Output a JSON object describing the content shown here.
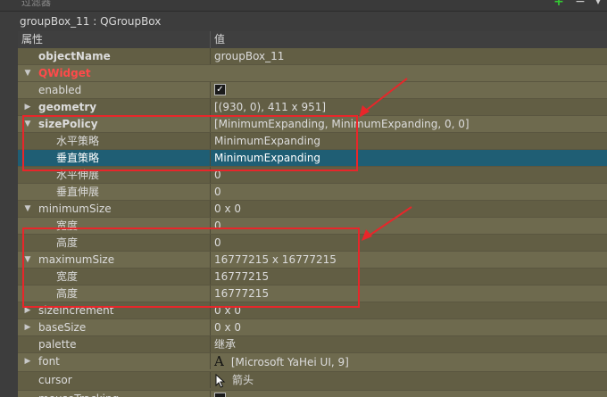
{
  "toolbar": {
    "filter_label": "过滤器",
    "add_icon": "plus-icon",
    "remove_icon": "minus-icon",
    "config_icon": "wrench-icon"
  },
  "object_title": "groupBox_11 : QGroupBox",
  "header": {
    "property": "属性",
    "value": "值"
  },
  "rows": [
    {
      "name": "objectName",
      "value": "groupBox_11"
    },
    {
      "name": "QWidget",
      "value": ""
    },
    {
      "name": "enabled",
      "value": "✓"
    },
    {
      "name": "geometry",
      "value": "[(930, 0), 411 x 951]"
    },
    {
      "name": "sizePolicy",
      "value": "[MinimumExpanding, MinimumExpanding, 0, 0]"
    },
    {
      "name": "水平策略",
      "value": "MinimumExpanding"
    },
    {
      "name": "垂直策略",
      "value": "MinimumExpanding"
    },
    {
      "name": "水平伸展",
      "value": "0"
    },
    {
      "name": "垂直伸展",
      "value": "0"
    },
    {
      "name": "minimumSize",
      "value": "0 x 0"
    },
    {
      "name": "宽度",
      "value": "0"
    },
    {
      "name": "高度",
      "value": "0"
    },
    {
      "name": "maximumSize",
      "value": "16777215 x 16777215"
    },
    {
      "name": "宽度",
      "value": "16777215"
    },
    {
      "name": "高度",
      "value": "16777215"
    },
    {
      "name": "sizeIncrement",
      "value": "0 x 0"
    },
    {
      "name": "baseSize",
      "value": "0 x 0"
    },
    {
      "name": "palette",
      "value": "继承"
    },
    {
      "name": "font",
      "value": "[Microsoft YaHei UI, 9]",
      "glyph": "A"
    },
    {
      "name": "cursor",
      "value": "箭头"
    },
    {
      "name": "mouseTracking",
      "value": ""
    }
  ],
  "colors": {
    "highlight_red": "#e8262a",
    "selection": "#1f5e74",
    "row_band_a": "#6e6a4e",
    "row_band_b": "#625e44"
  }
}
